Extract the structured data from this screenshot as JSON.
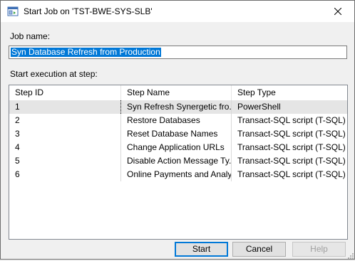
{
  "window": {
    "title": "Start Job on 'TST-BWE-SYS-SLB'",
    "icon": "sql-agent-job-icon",
    "close_icon": "close-icon"
  },
  "job_name": {
    "label": "Job name:",
    "value": "Syn Database Refresh from Production"
  },
  "steps": {
    "label": "Start execution at step:",
    "columns": [
      "Step ID",
      "Step Name",
      "Step Type"
    ],
    "rows": [
      {
        "id": "1",
        "name": "Syn Refresh Synergetic fro...",
        "type": "PowerShell",
        "selected": true
      },
      {
        "id": "2",
        "name": "Restore Databases",
        "type": "Transact-SQL script (T-SQL)"
      },
      {
        "id": "3",
        "name": "Reset Database Names",
        "type": "Transact-SQL script (T-SQL)"
      },
      {
        "id": "4",
        "name": "Change Application URLs",
        "type": "Transact-SQL script (T-SQL)"
      },
      {
        "id": "5",
        "name": "Disable Action Message Ty...",
        "type": "Transact-SQL script (T-SQL)"
      },
      {
        "id": "6",
        "name": "Online Payments and Analy...",
        "type": "Transact-SQL script (T-SQL)"
      }
    ]
  },
  "buttons": {
    "start": "Start",
    "cancel": "Cancel",
    "help": "Help"
  },
  "colors": {
    "selection": "#0078d7",
    "row_selected": "#e5e5e5",
    "disabled_text": "#a0a0a0"
  }
}
